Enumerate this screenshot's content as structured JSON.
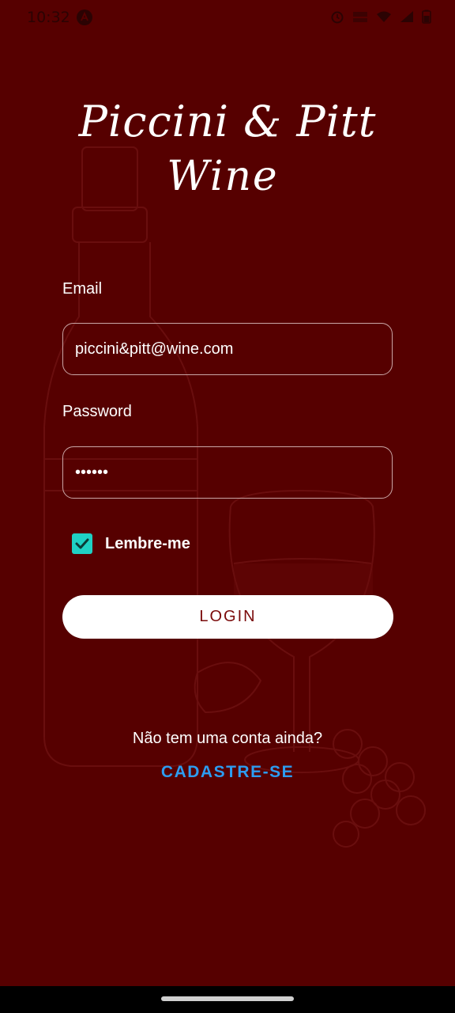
{
  "status_bar": {
    "time": "10:32"
  },
  "logo": {
    "line1": "Piccini & Pitt",
    "line2": "Wine"
  },
  "form": {
    "email_label": "Email",
    "email_value": "piccini&pitt@wine.com",
    "password_label": "Password",
    "password_value": "••••••",
    "remember_label": "Lembre-me",
    "remember_checked": true,
    "login_label": "LOGIN"
  },
  "footer": {
    "no_account_text": "Não tem uma conta ainda?",
    "signup_label": "CADASTRE-SE"
  },
  "colors": {
    "background": "#560000",
    "accent_checkbox": "#1fd1c4",
    "link": "#2d9cf0",
    "button_text": "#7a0a0a"
  }
}
